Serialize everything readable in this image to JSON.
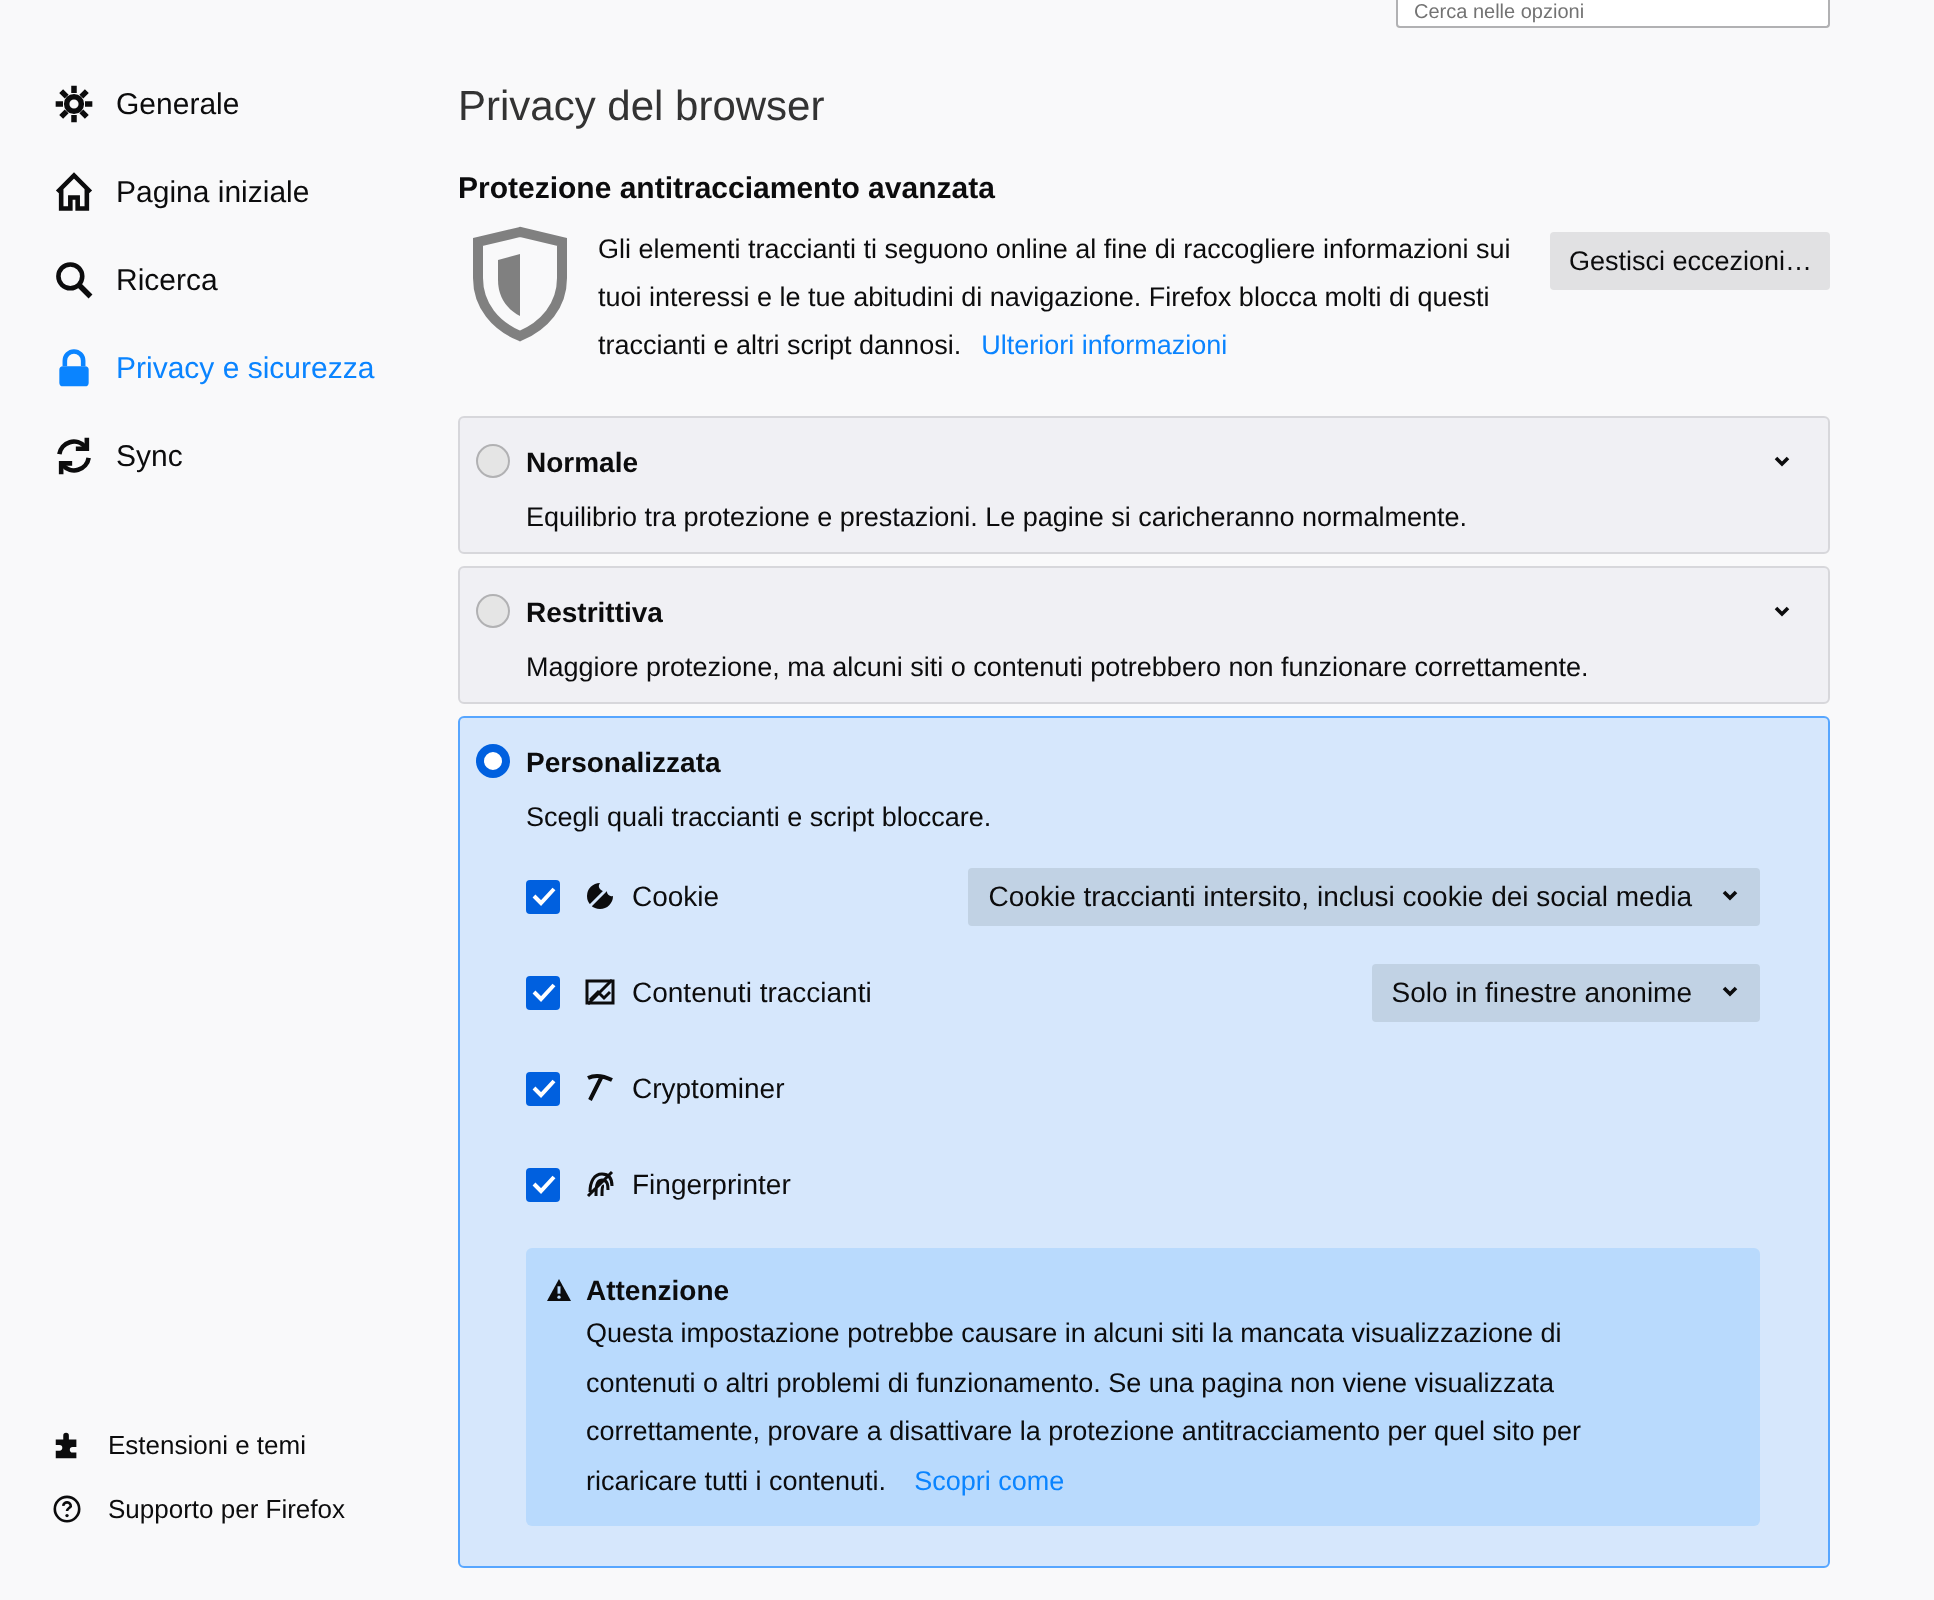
{
  "search": {
    "placeholder": "Cerca nelle opzioni"
  },
  "sidebar": {
    "items": [
      {
        "label": "Generale",
        "kind": "gear",
        "selected": false
      },
      {
        "label": "Pagina iniziale",
        "kind": "home",
        "selected": false
      },
      {
        "label": "Ricerca",
        "kind": "search",
        "selected": false
      },
      {
        "label": "Privacy e sicurezza",
        "kind": "lock",
        "selected": true
      },
      {
        "label": "Sync",
        "kind": "sync",
        "selected": false
      }
    ],
    "footer": [
      {
        "label": "Estensioni e temi",
        "kind": "puzzle"
      },
      {
        "label": "Supporto per Firefox",
        "kind": "help"
      }
    ]
  },
  "page_title": "Privacy del browser",
  "section": {
    "heading": "Protezione antitracciamento avanzata",
    "description": "Gli elementi traccianti ti seguono online al fine di raccogliere informazioni sui tuoi interessi e le tue abitudini di navigazione. Firefox blocca molti di questi traccianti e altri script dannosi.",
    "link": "Ulteriori informazioni",
    "button": "Gestisci eccezioni…"
  },
  "modes": [
    {
      "label": "Normale",
      "description": "Equilibrio tra protezione e prestazioni. Le pagine si caricheranno normalmente.",
      "selected": false
    },
    {
      "label": "Restrittiva",
      "description": "Maggiore protezione, ma alcuni siti o contenuti potrebbero non funzionare correttamente.",
      "selected": false
    },
    {
      "label": "Personalizzata",
      "description": "Scegli quali traccianti e script bloccare.",
      "selected": true,
      "options": [
        {
          "label": "Cookie",
          "kind": "cookie",
          "checked": true,
          "dropdown": "Cookie traccianti intersito, inclusi cookie dei social media"
        },
        {
          "label": "Contenuti traccianti",
          "kind": "content",
          "checked": true,
          "dropdown": "Solo in finestre anonime"
        },
        {
          "label": "Cryptominer",
          "kind": "miner",
          "checked": true
        },
        {
          "label": "Fingerprinter",
          "kind": "finger",
          "checked": true
        }
      ],
      "warning": {
        "title": "Attenzione",
        "text": "Questa impostazione potrebbe causare in alcuni siti la mancata visualizzazione di contenuti o altri problemi di funzionamento. Se una pagina non viene visualizzata correttamente, provare a disattivare la protezione antitracciamento per quel sito per ricaricare tutti i contenuti.",
        "link": "Scopri come"
      }
    }
  ]
}
